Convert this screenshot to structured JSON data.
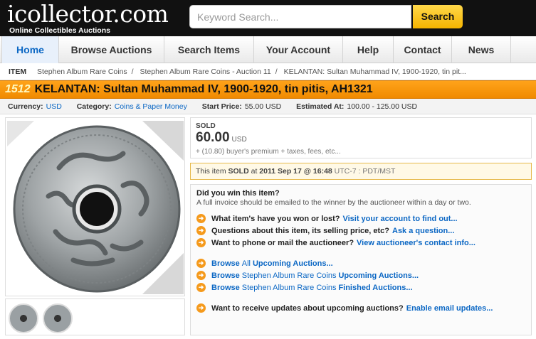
{
  "header": {
    "logo": "icollector.com",
    "tagline": "Online Collectibles Auctions",
    "search_placeholder": "Keyword Search...",
    "search_button": "Search"
  },
  "nav": [
    "Home",
    "Browse Auctions",
    "Search Items",
    "Your Account",
    "Help",
    "Contact",
    "News"
  ],
  "breadcrumb": {
    "label": "ITEM",
    "items": [
      "Stephen Album Rare Coins",
      "Stephen Album Rare Coins - Auction 11",
      "KELANTAN: Sultan Muhammad IV, 1900-1920, tin pit..."
    ]
  },
  "item": {
    "lot": "1512",
    "title": "KELANTAN: Sultan Muhammad IV, 1900-1920, tin pitis, AH1321"
  },
  "meta": {
    "currency_label": "Currency:",
    "currency": "USD",
    "category_label": "Category:",
    "category": "Coins & Paper Money",
    "start_label": "Start Price:",
    "start": "55.00 USD",
    "estimate_label": "Estimated At:",
    "estimate": "100.00 - 125.00 USD"
  },
  "sold": {
    "label": "SOLD",
    "amount": "60.00",
    "currency": "USD",
    "fees": "+ (10.80) buyer's premium + taxes, fees, etc..."
  },
  "notice": {
    "pre": "This item ",
    "sold": "SOLD",
    "mid": " at ",
    "date": "2011 Sep 17 @ 16:48",
    "tz": " UTC-7 : PDT/MST"
  },
  "info": {
    "question": "Did you win this item?",
    "subtext": "A full invoice should be emailed to the winner by the auctioneer within a day or two.",
    "rows": [
      {
        "text": "What item's have you won or lost?",
        "link": "Visit your account to find out..."
      },
      {
        "text": "Questions about this item, its selling price, etc?",
        "link": "Ask a question..."
      },
      {
        "text": "Want to phone or mail the auctioneer?",
        "link": "View auctioneer's contact info..."
      }
    ],
    "browse": [
      {
        "a": "Browse",
        "b": "All",
        "c": "Upcoming Auctions..."
      },
      {
        "a": "Browse",
        "b": "Stephen Album Rare Coins",
        "c": "Upcoming Auctions..."
      },
      {
        "a": "Browse",
        "b": "Stephen Album Rare Coins",
        "c": "Finished Auctions..."
      }
    ],
    "updates": {
      "text": "Want to receive updates about upcoming auctions?",
      "link": "Enable email updates..."
    }
  }
}
